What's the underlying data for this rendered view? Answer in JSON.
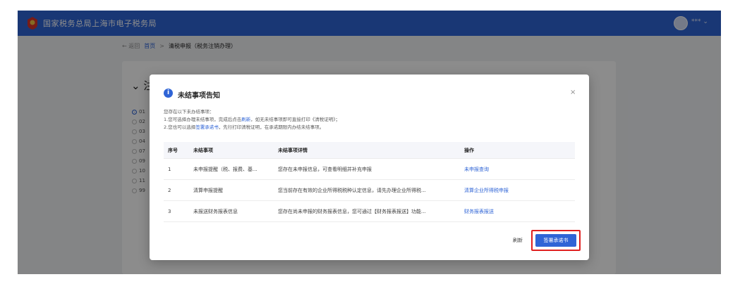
{
  "header": {
    "site_title": "国家税务总局上海市电子税务局",
    "user_name": "*** ⌄"
  },
  "breadcrumb": {
    "back": "← 返回",
    "home": "首页",
    "separator": ">",
    "current": "清税申报（税务注销办理）"
  },
  "background": {
    "section_title": "⌄ 注",
    "options": [
      "01",
      "02",
      "03",
      "04",
      "07",
      "09",
      "10",
      "11",
      "99"
    ]
  },
  "modal": {
    "title": "未结事项告知",
    "close": "×",
    "desc_line1": "您存在以下未办结事项：",
    "desc_line2_prefix": "1.您可选择办理未结事项，完成后点击",
    "desc_line2_link": "刷新",
    "desc_line2_suffix": "，如无未结事项即可直接打印《清税证明》；",
    "desc_line3_prefix": "2.您也可以选择",
    "desc_line3_link": "签署承诺书",
    "desc_line3_suffix": "，先行打印清税证明，在承诺期限内办结未结事项。",
    "table": {
      "headers": [
        "序号",
        "未结事项",
        "未结事项详情",
        "操作"
      ],
      "rows": [
        {
          "no": "1",
          "item": "未申报提醒（税、报费、基...",
          "detail": "您存在未申报信息，可查看明细并补充申报",
          "action": "未申报查询"
        },
        {
          "no": "2",
          "item": "清算申报提醒",
          "detail": "您当前存在有效的企业所得税税种认定信息，请先办理企业所得税...",
          "action": "清算企业所得税申报"
        },
        {
          "no": "3",
          "item": "未报送财务报表信息",
          "detail": "您存在尚未申报的财务报表信息，您可通过【财务报表报送】功能...",
          "action": "财务报表报送"
        }
      ]
    },
    "refresh_button": "刷新",
    "commit_button": "签署承诺书"
  },
  "colors": {
    "brand": "#2f64d6",
    "highlight": "#e02020"
  }
}
